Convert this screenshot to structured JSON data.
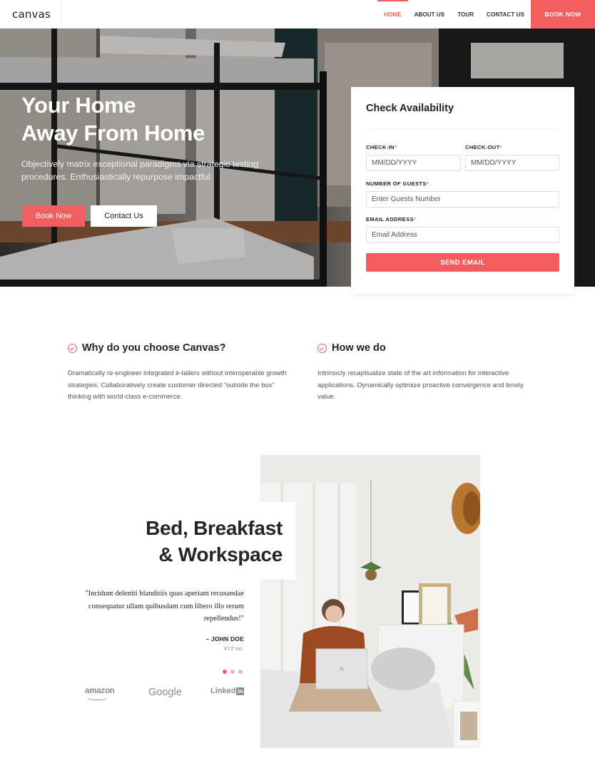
{
  "header": {
    "logo": "canvas",
    "nav": [
      {
        "label": "HOME",
        "active": true
      },
      {
        "label": "ABOUT US",
        "active": false
      },
      {
        "label": "TOUR",
        "active": false
      },
      {
        "label": "CONTACT US",
        "active": false
      }
    ],
    "cta": "BOOK NOW"
  },
  "hero": {
    "title_line1": "Your Home",
    "title_line2": "Away From Home",
    "subtitle": "Objectively matrix exceptional paradigms via strategic testing procedures. Enthusiastically repurpose impactful.",
    "primary_button": "Book Now",
    "secondary_button": "Contact Us"
  },
  "availability": {
    "title": "Check Availability",
    "checkin_label": "CHECK-IN",
    "checkin_placeholder": "MM/DD/YYYY",
    "checkout_label": "CHECK-OUT",
    "checkout_placeholder": "MM/DD/YYYY",
    "guests_label": "NUMBER OF GUESTS",
    "guests_placeholder": "Enter Guests Number",
    "email_label": "EMAIL ADDRESS",
    "email_placeholder": "Email Address",
    "required_mark": "*",
    "submit": "SEND EMAIL"
  },
  "features": [
    {
      "title": "Why do you choose Canvas?",
      "text": "Dramatically re-engineer integrated e-tailers without interoperable growth strategies. Collaboratively create customer directed \"outside the box\" thinking with world-class e-commerce."
    },
    {
      "title": "How we do",
      "text": "Intrinsicly recaptiualize state of the art information for interactive applications. Dynamically optimize proactive convergence and timely value."
    }
  ],
  "showcase": {
    "title_line1": "Bed, Breakfast",
    "title_line2": "& Workspace",
    "quote": "\"Incidunt deleniti blanditiis quas aperiam recusandae consequatur ullam quibusdam cum libero illo rerum repellendus!\"",
    "author": "– JOHN DOE",
    "company": "XYZ Inc.",
    "slider_active_index": 0,
    "slider_count": 3,
    "brands": [
      "amazon",
      "Google",
      "Linked",
      "in"
    ]
  },
  "colors": {
    "accent": "#f45d5d",
    "dark_text": "#23272b",
    "muted_text": "#555555"
  }
}
